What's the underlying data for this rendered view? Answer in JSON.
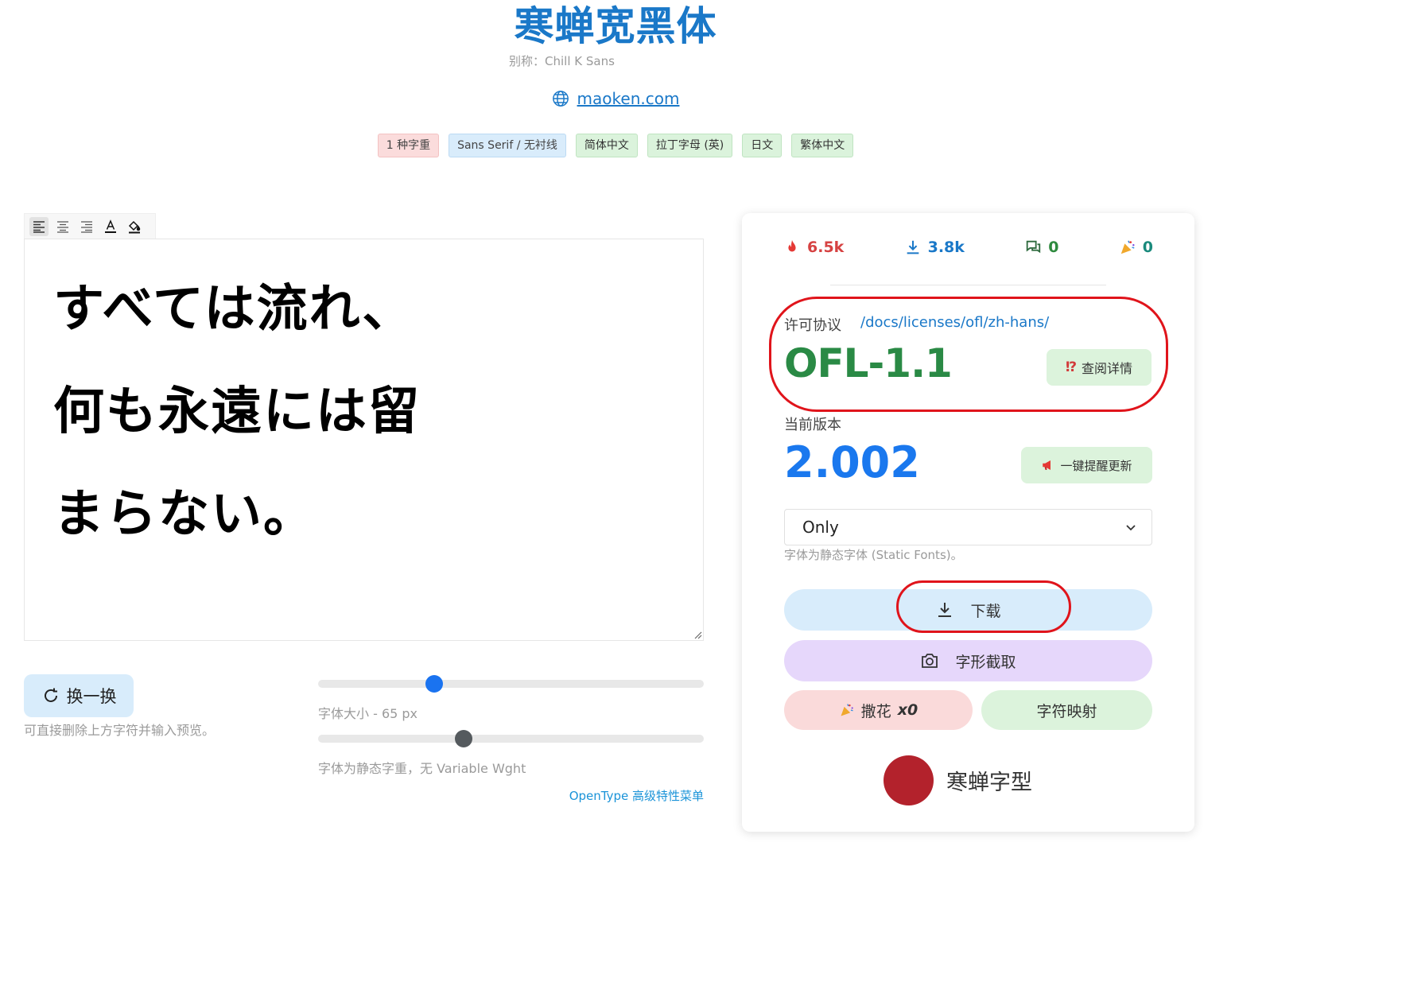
{
  "header": {
    "title": "寒蝉宽黑体",
    "alias": "别称：Chill K Sans",
    "site_link": "maoken.com"
  },
  "tags": [
    {
      "label": "1 种字重",
      "color": "red"
    },
    {
      "label": "Sans Serif / 无衬线",
      "color": "blue"
    },
    {
      "label": "简体中文",
      "color": "green"
    },
    {
      "label": "拉丁字母 (英)",
      "color": "green"
    },
    {
      "label": "日文",
      "color": "green"
    },
    {
      "label": "繁体中文",
      "color": "green"
    }
  ],
  "editor": {
    "toolbar_icons": [
      "align-left-icon",
      "align-center-icon",
      "align-right-icon",
      "text-color-icon",
      "fill-color-icon"
    ],
    "lines": [
      "すべては流れ、",
      "何も永遠には留",
      "まらない。"
    ]
  },
  "controls": {
    "swap_label": "换一换",
    "hint": "可直接删除上方字符并输入预览。",
    "size_label": "字体大小 - 65 px",
    "size_fraction": 0.3,
    "weight_label": "字体为静态字重，无 Variable Wght",
    "weight_fraction": 0.377,
    "opentype_link": "OpenType 高级特性菜单"
  },
  "card": {
    "stats": {
      "views": "6.5k",
      "downloads": "3.8k",
      "comments": "0",
      "confetti": "0"
    },
    "license_label": "许可协议",
    "license_link": "/docs/licenses/ofl/zh-hans/",
    "license_name": "OFL-1.1",
    "license_detail_button": "查阅详情",
    "version_label": "当前版本",
    "version": "2.002",
    "notify_button": "一键提醒更新",
    "style_select": "Only",
    "static_note": "字体为静态字体 (Static Fonts)。",
    "download_button": "下载",
    "glyph_capture_button": "字形截取",
    "confetti_button": "撒花",
    "confetti_count": "x0",
    "charmap_button": "字符映射",
    "foundry_name": "寒蝉字型"
  },
  "colors": {
    "accent": "#1a78c8",
    "license_green": "#2a8a45",
    "version_blue": "#1a78ee",
    "highlight_ring": "#e0141b",
    "foundry_logo": "#b3222c"
  }
}
